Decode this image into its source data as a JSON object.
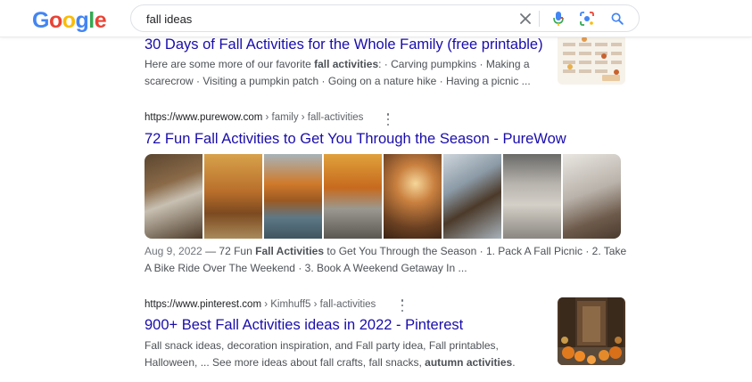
{
  "header": {
    "logo_letters": [
      {
        "ch": "G",
        "color": "#4285f4"
      },
      {
        "ch": "o",
        "color": "#ea4335"
      },
      {
        "ch": "o",
        "color": "#fbbc05"
      },
      {
        "ch": "g",
        "color": "#4285f4"
      },
      {
        "ch": "l",
        "color": "#34a853"
      },
      {
        "ch": "e",
        "color": "#ea4335"
      }
    ],
    "search_value": "fall ideas",
    "icons": [
      "close-icon",
      "mic-icon",
      "camera-lens-icon",
      "search-icon"
    ]
  },
  "results": [
    {
      "title": "30 Days of Fall Activities for the Whole Family (free printable)",
      "snippet_pre": "Here are some more of our favorite ",
      "snippet_bold": "fall activities",
      "snippet_post": ": · Carving pumpkins · Making a scarecrow · Visiting a pumpkin patch · Going on a nature hike · Having a picnic ..."
    },
    {
      "cite_domain": "https://www.purewow.com",
      "cite_path": " › family › fall-activities",
      "title": "72 Fun Fall Activities to Get You Through the Season - PureWow",
      "date": "Aug 9, 2022",
      "snippet_pre": " — 72 Fun ",
      "snippet_bold": "Fall Activities",
      "snippet_post": " to Get You Through the Season · 1. Pack A Fall Picnic · 2. Take A Bike Ride Over The Weekend · 3. Book A Weekend Getaway In ..."
    },
    {
      "cite_domain": "https://www.pinterest.com",
      "cite_path": " › Kimhuff5 › fall-activities",
      "title": "900+ Best Fall Activities ideas in 2022 - Pinterest",
      "snippet_pre": "Fall snack ideas, decoration inspiration, and Fall party idea, Fall printables, Halloween, ... See more ideas about fall crafts, fall snacks, ",
      "snippet_bold": "autumn activities",
      "snippet_post": "."
    }
  ]
}
